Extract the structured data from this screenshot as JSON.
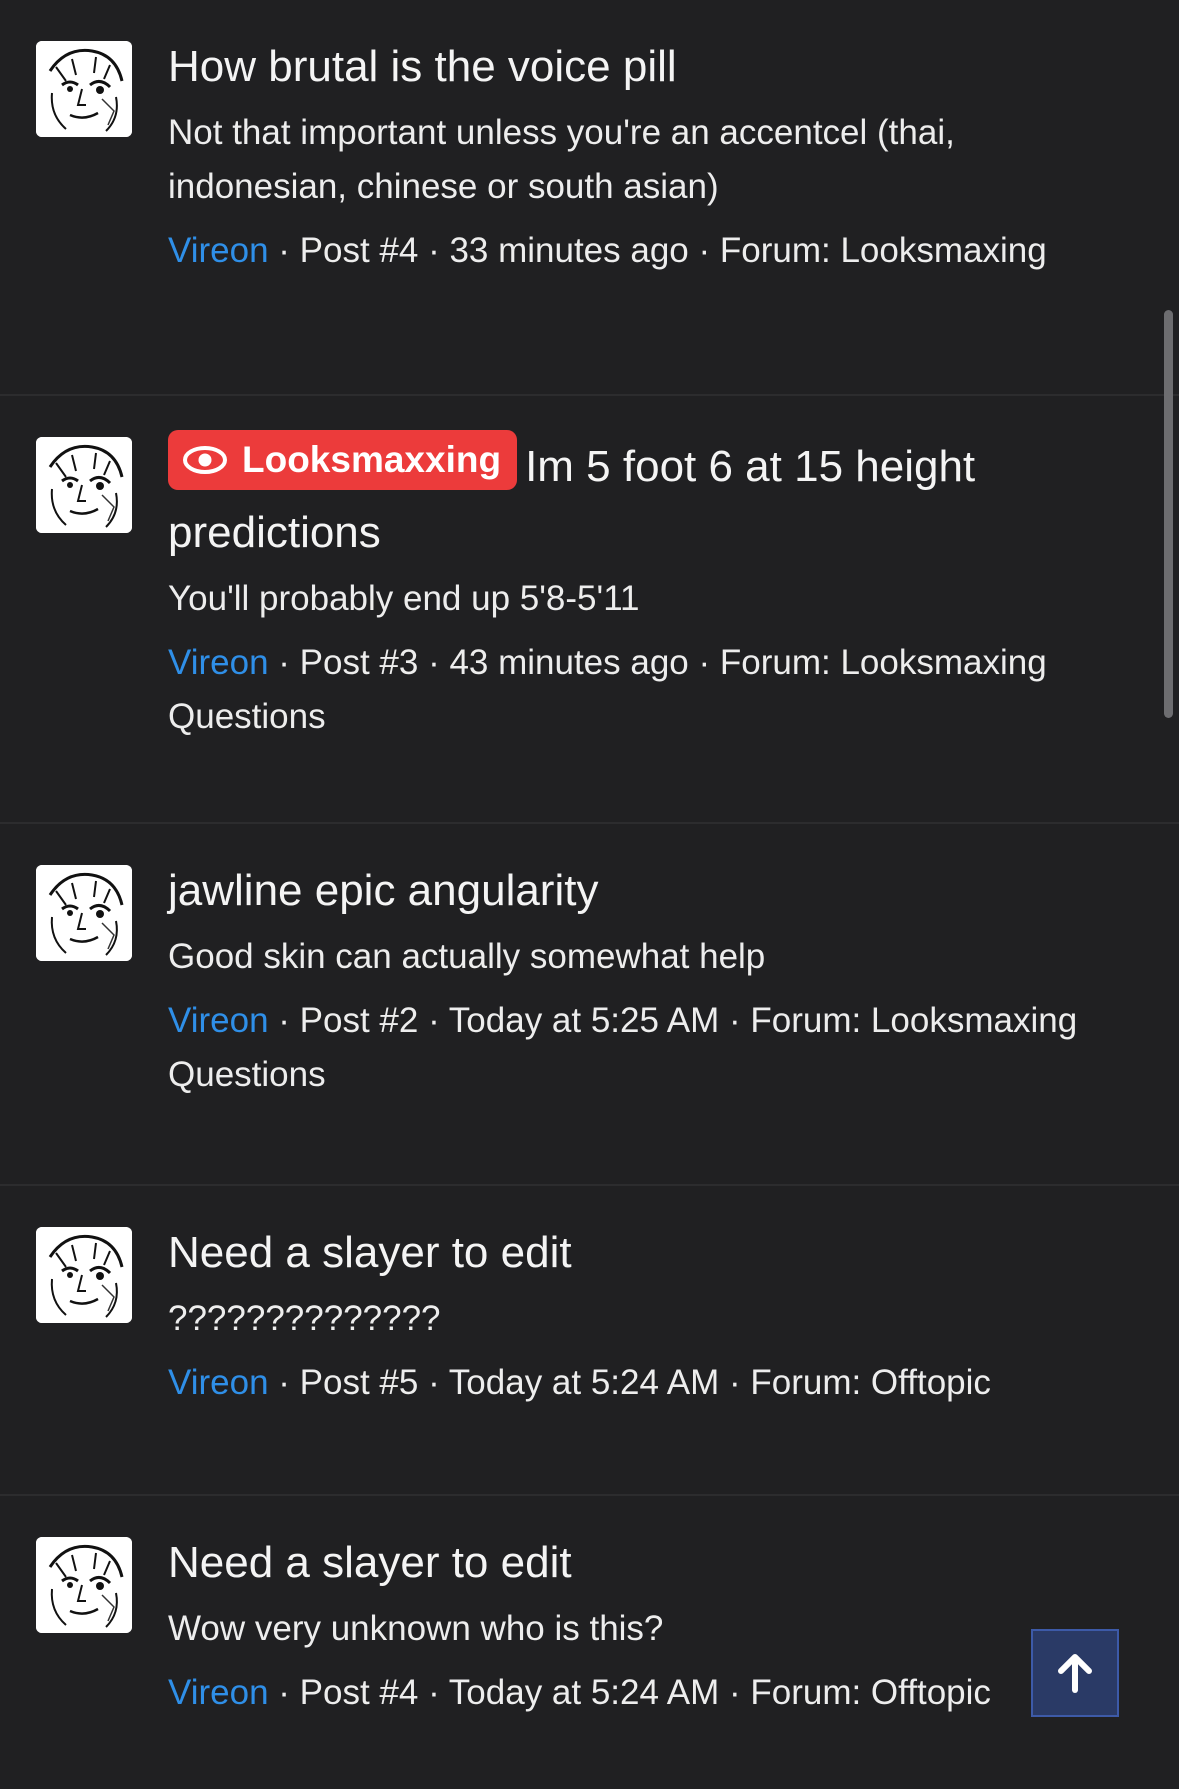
{
  "posts": [
    {
      "title": "How brutal is the voice pill",
      "snippet": "Not that important unless you're an accentcel (thai, indonesian, chinese or south asian)",
      "user": "Vireon",
      "meta": " · Post #4 · 33 minutes ago · Forum: Looksmaxing"
    },
    {
      "badge": "Looksmaxxing",
      "title": "Im 5 foot 6 at 15 height predictions",
      "snippet": "You'll probably end up 5'8-5'11",
      "user": "Vireon",
      "meta": " · Post #3 · 43 minutes ago · Forum: Looksmaxing Questions"
    },
    {
      "title": "jawline epic angularity",
      "snippet": "Good skin can actually somewhat help",
      "user": "Vireon",
      "meta": " · Post #2 · Today at 5:25 AM · Forum: Looksmaxing Questions"
    },
    {
      "title": "Need a slayer to edit",
      "snippet": "??????????????",
      "user": "Vireon",
      "meta": " · Post #5 · Today at 5:24 AM · Forum: Offtopic"
    },
    {
      "title": "Need a slayer to edit",
      "snippet": "Wow very unknown who is this?",
      "user": "Vireon",
      "meta": " · Post #4 · Today at 5:24 AM · Forum: Offtopic"
    }
  ],
  "colors": {
    "background": "#202022",
    "username": "#2f8fe8",
    "badge": "#ec3b3b",
    "scroll_top_button": "#2a3a66"
  },
  "icons": {
    "badge_icon": "eye-icon",
    "scroll_top_icon": "arrow-up-icon"
  }
}
